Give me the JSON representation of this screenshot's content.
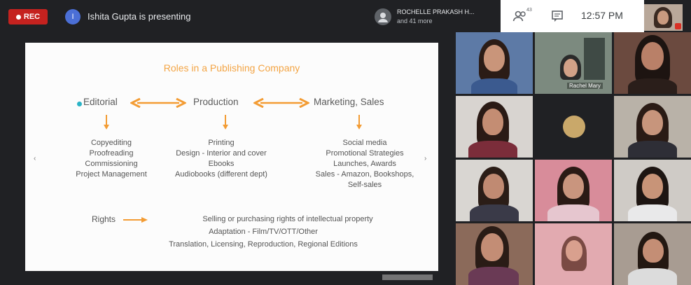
{
  "topbar": {
    "rec_label": "REC",
    "presenter_initial": "I",
    "presenting_text": "Ishita Gupta is presenting",
    "participants_line1": "ROCHELLE PRAKASH H...",
    "participants_line2": "and 41 more",
    "people_count": "43",
    "time": "12:57 PM"
  },
  "slide": {
    "title": "Roles in a Publishing Company",
    "roles": [
      "Editorial",
      "Production",
      "Marketing, Sales"
    ],
    "editorial_items": [
      "Copyediting",
      "Proofreading",
      "Commissioning",
      "Project Management"
    ],
    "production_items": [
      "Printing",
      "Design - Interior and cover",
      "Ebooks",
      "Audiobooks (different dept)"
    ],
    "marketing_items": [
      "Social media",
      "Promotional Strategies",
      "Launches, Awards",
      "Sales - Amazon, Bookshops,",
      "Self-sales"
    ],
    "rights_label": "Rights",
    "rights_lines": [
      "Selling or purchasing rights of intellectual property",
      "Adaptation - Film/TV/OTT/Other",
      "Translation, Licensing, Reproduction, Regional Editions"
    ],
    "prev_arrow": "‹",
    "next_arrow": "›",
    "accent_color": "#f3a545",
    "bullet_color": "#2ab3c6"
  },
  "grid": {
    "tile_label": "Rachel Mary"
  }
}
